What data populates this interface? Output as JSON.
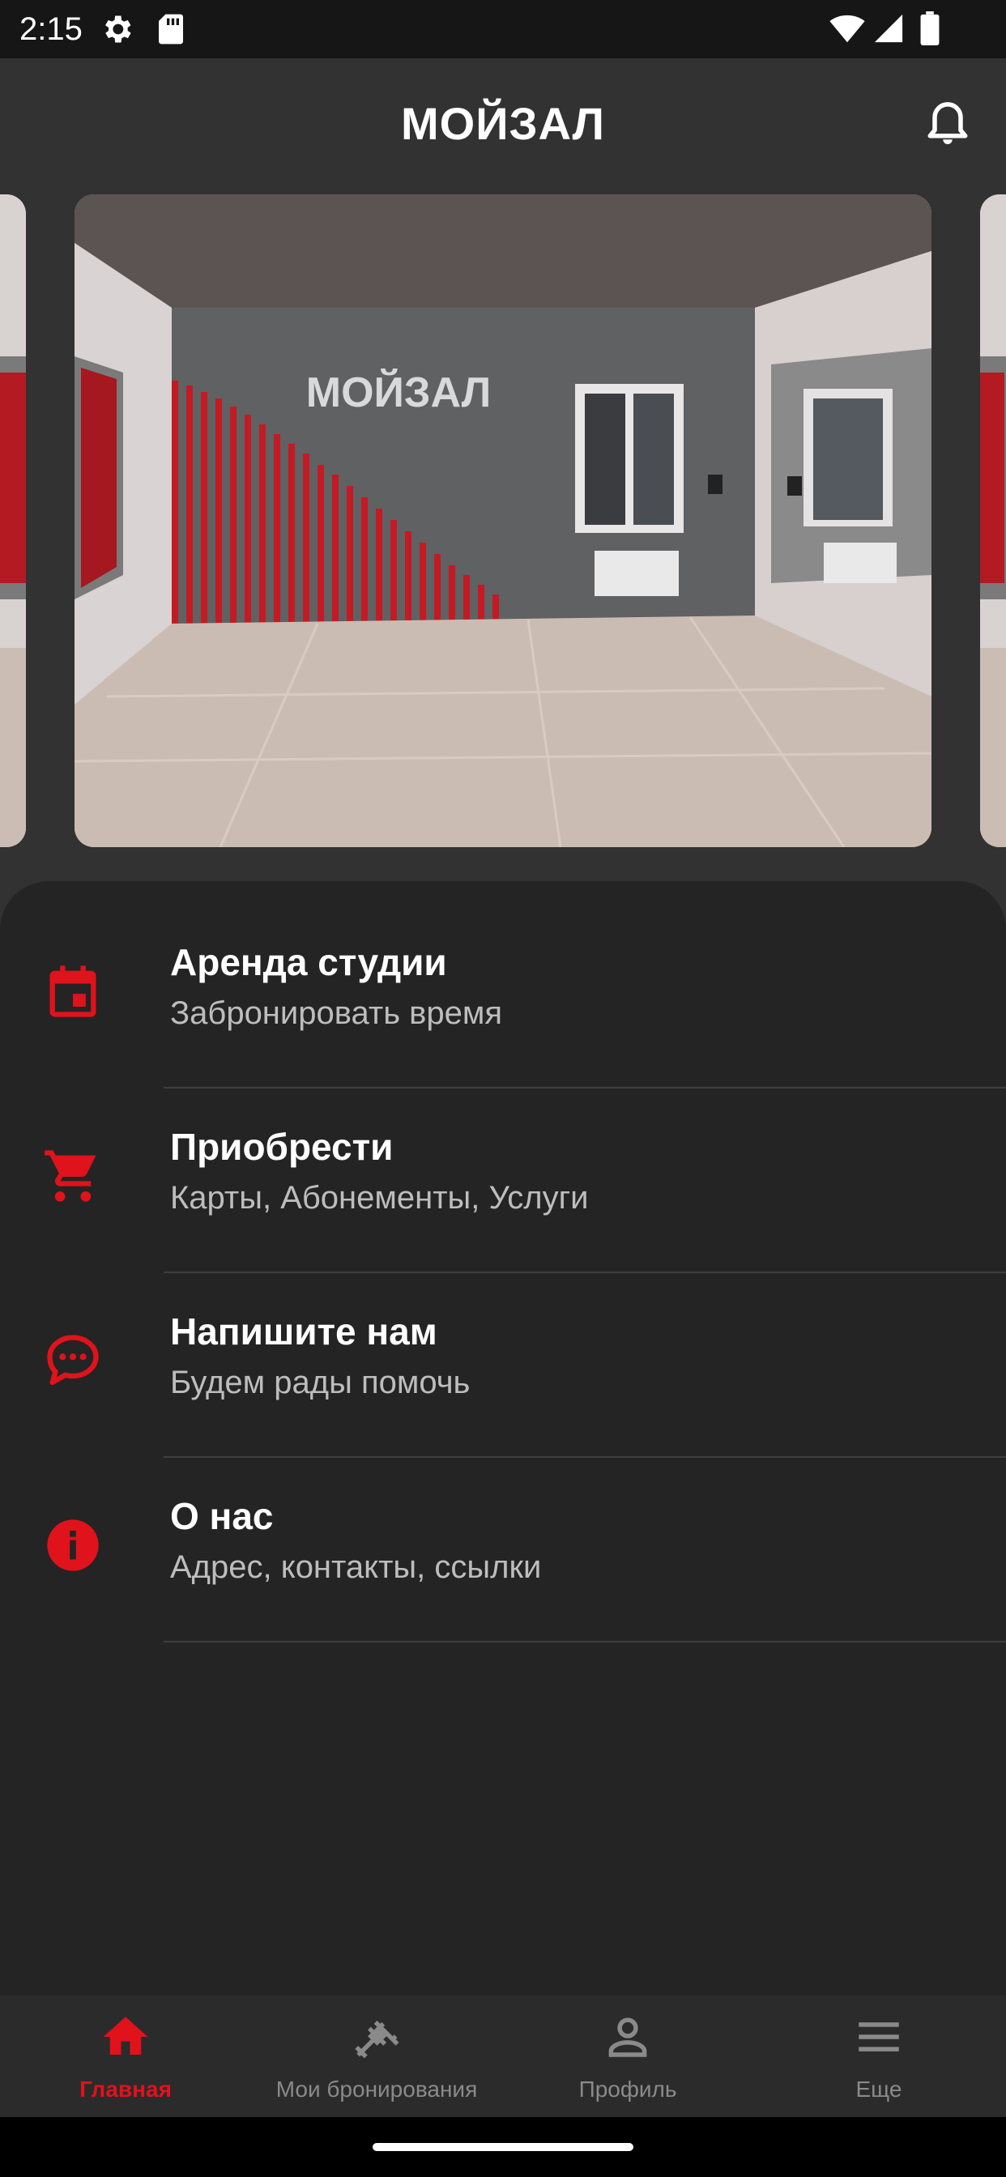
{
  "status_bar": {
    "time": "2:15",
    "icons": [
      "gear-icon",
      "sd-card-icon",
      "wifi-icon",
      "signal-icon",
      "battery-icon"
    ]
  },
  "app_bar": {
    "title": "МОЙЗАЛ",
    "notification_icon": "bell-icon"
  },
  "carousel": {
    "wall_logo": "МОЙЗАЛ"
  },
  "menu": {
    "items": [
      {
        "icon": "calendar-icon",
        "title": "Аренда студии",
        "subtitle": "Забронировать время"
      },
      {
        "icon": "cart-icon",
        "title": "Приобрести",
        "subtitle": "Карты, Абонементы, Услуги"
      },
      {
        "icon": "chat-icon",
        "title": "Напишите нам",
        "subtitle": "Будем рады помочь"
      },
      {
        "icon": "info-icon",
        "title": "О нас",
        "subtitle": "Адрес, контакты, ссылки"
      }
    ]
  },
  "bottom_nav": {
    "items": [
      {
        "icon": "home-icon",
        "label": "Главная",
        "active": true
      },
      {
        "icon": "dumbbell-icon",
        "label": "Мои бронирования",
        "active": false
      },
      {
        "icon": "person-icon",
        "label": "Профиль",
        "active": false
      },
      {
        "icon": "menu-icon",
        "label": "Еще",
        "active": false
      }
    ]
  },
  "colors": {
    "accent": "#e0121b",
    "background": "#323232",
    "sheet": "#242424",
    "text_primary": "#ffffff",
    "text_secondary": "#bdbdbd",
    "nav_inactive": "#8a8a8a"
  }
}
